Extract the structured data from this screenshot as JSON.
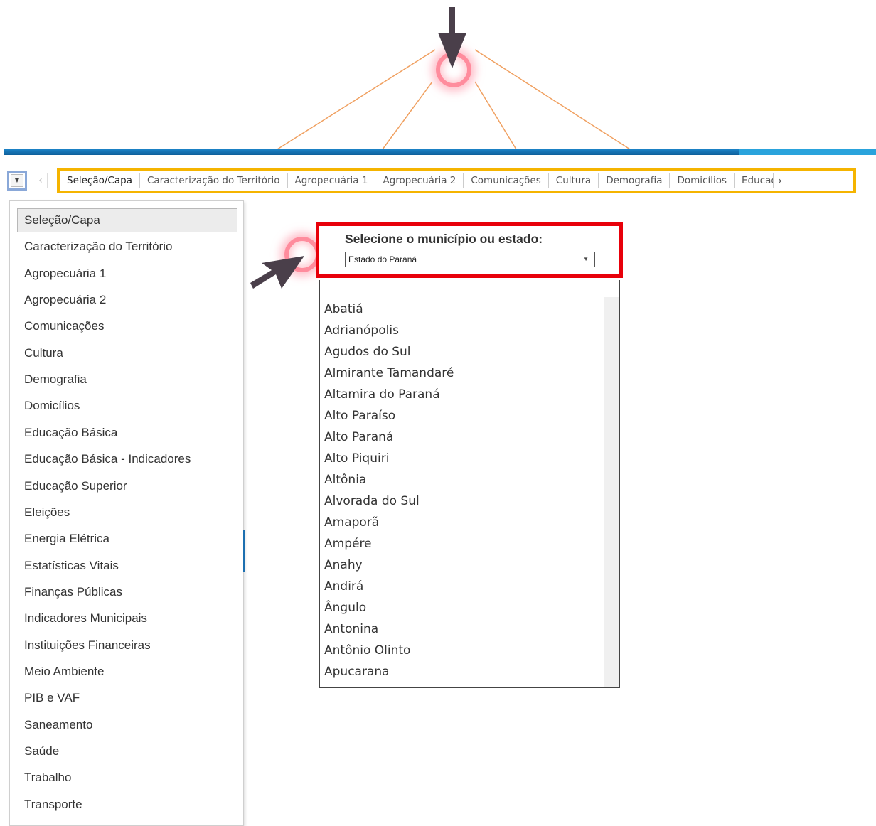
{
  "tabs": {
    "items": [
      "Seleção/Capa",
      "Caracterização do Território",
      "Agropecuária 1",
      "Agropecuária 2",
      "Comunicações",
      "Cultura",
      "Demografia",
      "Domicílios",
      "Educaçã"
    ],
    "active": "Seleção/Capa",
    "prev_icon": "chevron-left-icon",
    "next_icon": "chevron-right-icon"
  },
  "menu": {
    "items": [
      "Seleção/Capa",
      "Caracterização do Território",
      "Agropecuária 1",
      "Agropecuária 2",
      "Comunicações",
      "Cultura",
      "Demografia",
      "Domicílios",
      "Educação Básica",
      "Educação Básica - Indicadores",
      "Educação Superior",
      "Eleições",
      "Energia Elétrica",
      "Estatísticas Vitais",
      "Finanças Públicas",
      "Indicadores Municipais",
      "Instituições Financeiras",
      "Meio Ambiente",
      "PIB e VAF",
      "Saneamento",
      "Saúde",
      "Trabalho",
      "Transporte"
    ],
    "active": "Seleção/Capa"
  },
  "selector": {
    "label": "Selecione o município ou estado:",
    "value": "Estado do Paraná"
  },
  "dropdown": {
    "options": [
      "Abatiá",
      "Adrianópolis",
      "Agudos do Sul",
      "Almirante Tamandaré",
      "Altamira do Paraná",
      "Alto Paraíso",
      "Alto Paraná",
      "Alto Piquiri",
      "Altônia",
      "Alvorada do Sul",
      "Amaporã",
      "Ampére",
      "Anahy",
      "Andirá",
      "Ângulo",
      "Antonina",
      "Antônio Olinto",
      "Apucarana"
    ]
  },
  "colors": {
    "highlight_tabs": "#f5b400",
    "highlight_selector": "#e8000a",
    "accent_bar": "#1c83c7",
    "annotation_line": "#f0a060",
    "pulse": "#ff8096"
  }
}
